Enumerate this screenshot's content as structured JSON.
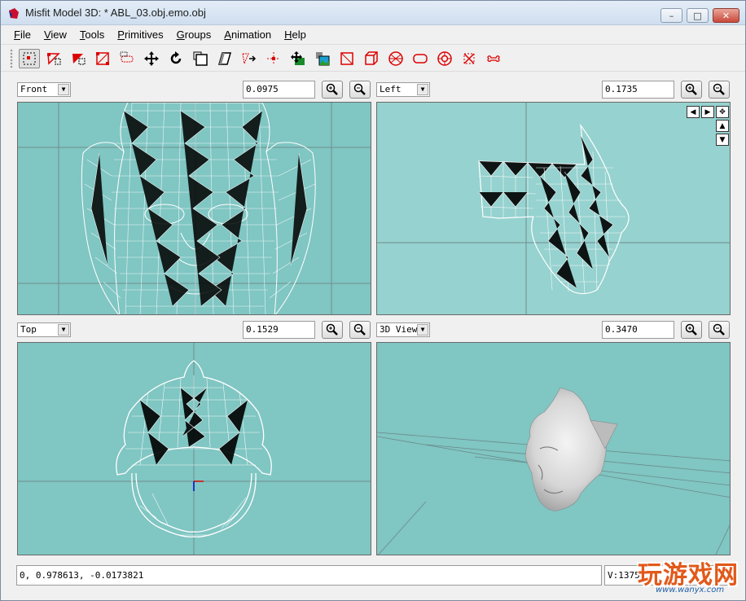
{
  "window": {
    "title": "Misfit Model 3D: * ABL_03.obj.emo.obj",
    "minimize_glyph": "–",
    "maximize_glyph": "□",
    "close_glyph": "✕"
  },
  "menu": [
    {
      "accel": "F",
      "rest": "ile"
    },
    {
      "accel": "V",
      "rest": "iew"
    },
    {
      "accel": "T",
      "rest": "ools"
    },
    {
      "accel": "P",
      "rest": "rimitives"
    },
    {
      "accel": "G",
      "rest": "roups"
    },
    {
      "accel": "A",
      "rest": "nimation"
    },
    {
      "accel": "H",
      "rest": "elp"
    }
  ],
  "toolbar": {
    "tools": [
      "select-vertices-icon",
      "select-faces-icon",
      "select-connected-icon",
      "select-groups-icon",
      "select-bones-icon",
      "move-icon",
      "rotate-icon",
      "scale-icon",
      "shear-icon",
      "extrude-icon",
      "attach-icon",
      "add-vertex-icon",
      "texture-icon",
      "rectangle-icon",
      "cube-icon",
      "ellipsoid-icon",
      "cylinder-icon",
      "torus-icon",
      "polygon-icon",
      "joint-icon"
    ]
  },
  "viewports": {
    "top_left": {
      "view": "Front",
      "zoom": "0.0975"
    },
    "top_right": {
      "view": "Left",
      "zoom": "0.1735"
    },
    "bottom_left": {
      "view": "Top",
      "zoom": "0.1529"
    },
    "bottom_right": {
      "view": "3D View",
      "zoom": "0.3470"
    }
  },
  "colors": {
    "viewport_bg": "#80c6c3",
    "viewport_bg_left": "#96d2cf",
    "wireframe": "#ffffff",
    "grid": "#6f8f8e"
  },
  "status": {
    "coords": "0, 0.978613, -0.0173821",
    "right": "V:1375"
  },
  "watermark": {
    "text": "玩游戏网",
    "url": "www.wanyx.com"
  }
}
